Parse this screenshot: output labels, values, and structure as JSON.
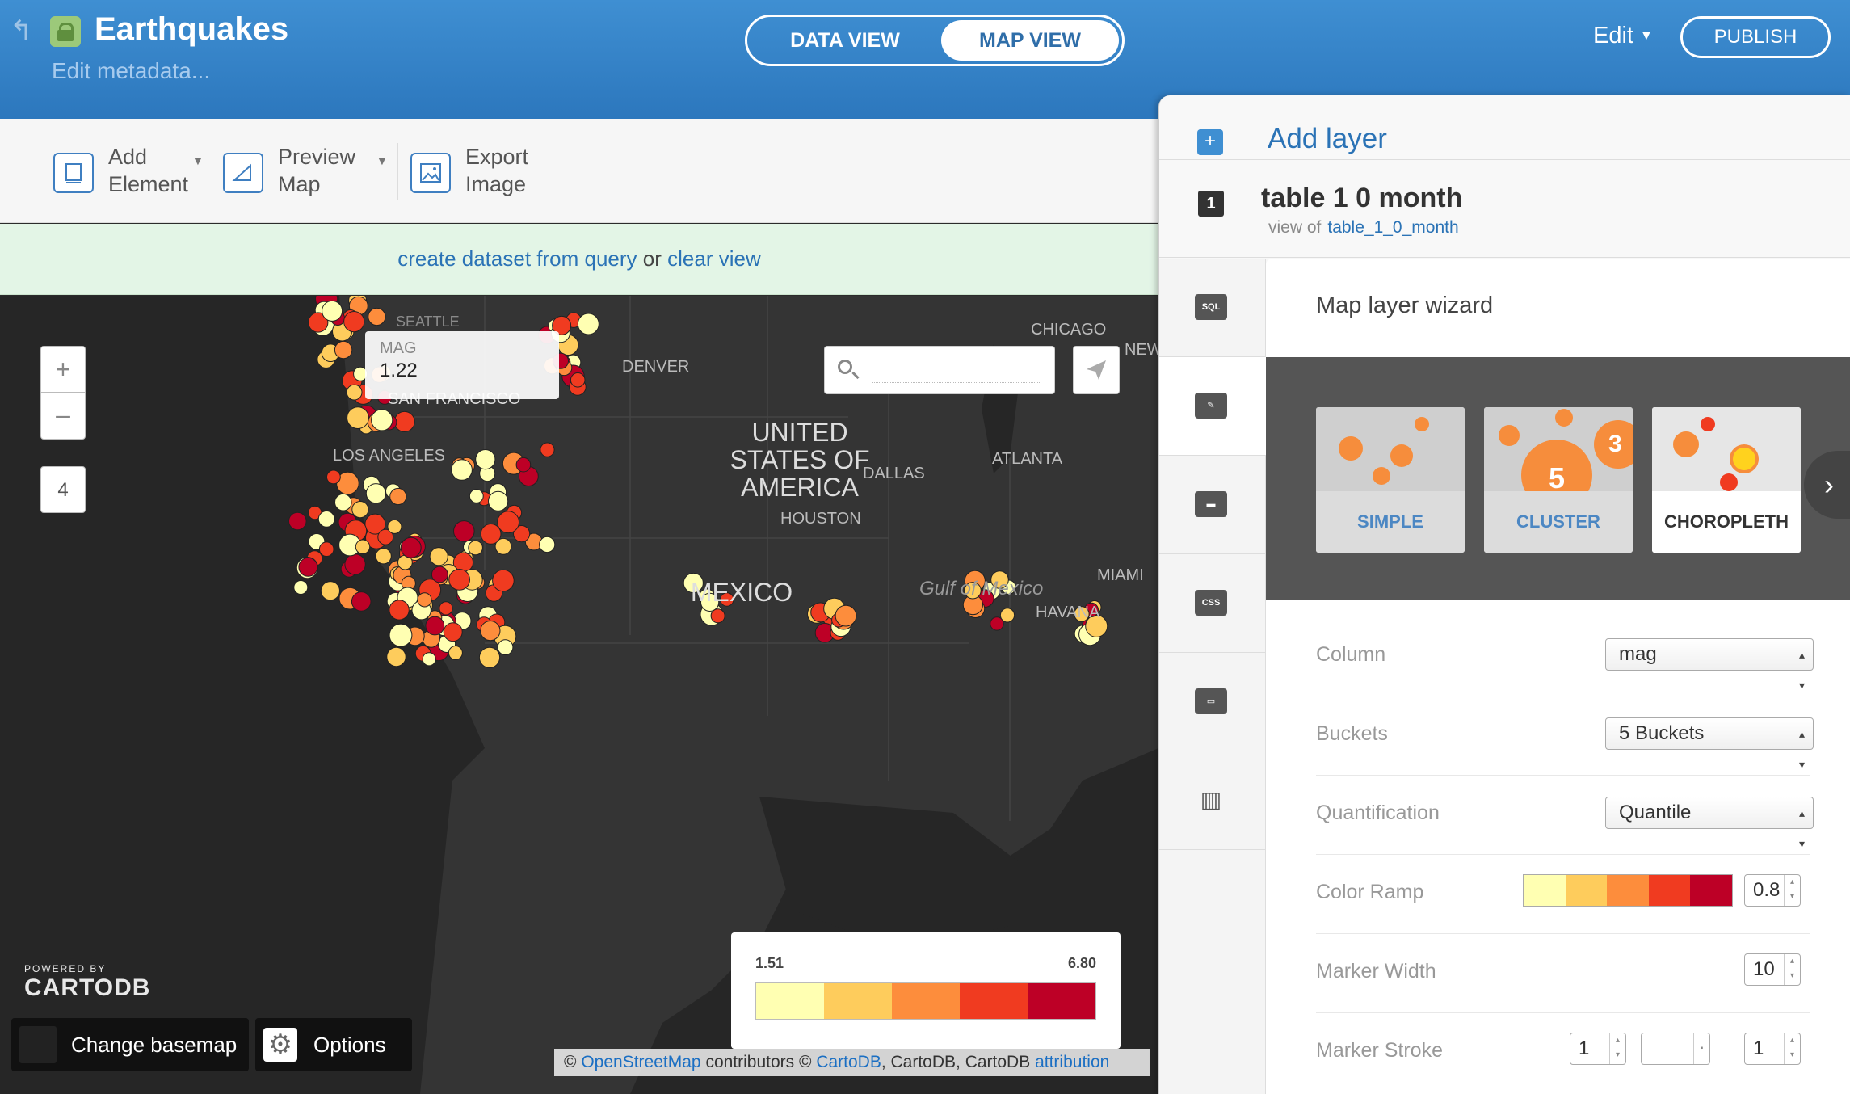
{
  "header": {
    "title": "Earthquakes",
    "subtitle": "Edit metadata...",
    "tabs": [
      "DATA VIEW",
      "MAP VIEW"
    ],
    "active_tab": "MAP VIEW",
    "edit_label": "Edit",
    "publish_label": "PUBLISH"
  },
  "toolbar": {
    "add_element": "Add\nElement",
    "preview_map": "Preview\nMap",
    "export_image": "Export\nImage"
  },
  "query_bar": {
    "create_link": "create dataset from query",
    "or_text": "or",
    "clear_link": "clear view"
  },
  "map": {
    "zoom_in": "+",
    "zoom_out": "–",
    "zoom_level": "4",
    "tooltip": {
      "key": "MAG",
      "value": "1.22"
    },
    "labels": [
      "SEATTLE",
      "CHICAGO",
      "NEW",
      "UNITED",
      "STATES OF",
      "AMERICA",
      "DENVER",
      "SAN FRANCISCO",
      "LOS ANGELES",
      "DALLAS",
      "ATLANTA",
      "HOUSTON",
      "MIAMI",
      "Gulf of Mexico",
      "HAVANA",
      "MEXICO"
    ],
    "legend": {
      "min": "1.51",
      "max": "6.80"
    },
    "powered_small": "POWERED BY",
    "powered_logo": "CARTODB",
    "basemap_label": "Change basemap",
    "options_label": "Options",
    "attribution": {
      "prefix": "©",
      "osm": "OpenStreetMap",
      "contrib": "contributors ©",
      "cartodb": "CartoDB",
      "mid": ", CartoDB, CartoDB",
      "attribution": "attribution"
    }
  },
  "panel": {
    "add_layer": "Add layer",
    "layer_number": "1",
    "layer_name": "table 1 0 month",
    "view_of_label": "view of",
    "view_of_link": "table_1_0_month",
    "nav_icons": [
      "sql-icon",
      "brush-icon",
      "infowindow-icon",
      "css-icon",
      "legend-icon",
      "histogram-icon"
    ],
    "nav_sql": "SQL",
    "nav_css": "CSS",
    "wizard_title": "Map layer wizard",
    "cards": [
      "SIMPLE",
      "CLUSTER",
      "CHOROPLETH"
    ],
    "cluster_thumb": [
      "5",
      "3"
    ],
    "active_card": "CHOROPLETH",
    "rows": {
      "column_label": "Column",
      "column_value": "mag",
      "buckets_label": "Buckets",
      "buckets_value": "5 Buckets",
      "quant_label": "Quantification",
      "quant_value": "Quantile",
      "ramp_label": "Color Ramp",
      "ramp_opacity": "0.8",
      "width_label": "Marker Width",
      "width_value": "10",
      "stroke_label": "Marker Stroke",
      "stroke_width": "1",
      "stroke_opacity": "1"
    }
  },
  "colors": {
    "ramp": [
      "#ffffb2",
      "#fecc5c",
      "#fd8d3c",
      "#f03b20",
      "#bd0026"
    ],
    "brand_blue": "#2c77bd"
  }
}
